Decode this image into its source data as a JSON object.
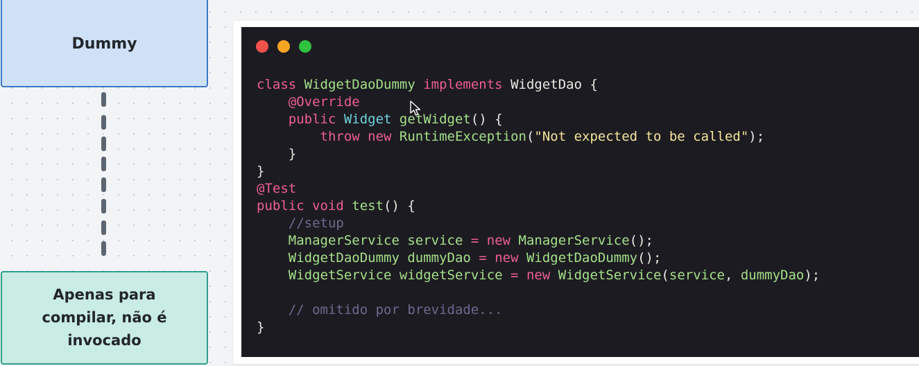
{
  "diagram": {
    "top_box": {
      "label": "Dummy"
    },
    "bottom_box": {
      "lines": [
        "Apenas para",
        "compilar, não é",
        "invocado"
      ]
    }
  },
  "window_controls": [
    {
      "name": "close-dot",
      "color": "#f0524b"
    },
    {
      "name": "minimize-dot",
      "color": "#f4a623"
    },
    {
      "name": "maximize-dot",
      "color": "#2fc23f"
    }
  ],
  "code_colors": {
    "keyword": "#ee5f93",
    "type": "#a5e089",
    "interface": "#ebe9e3",
    "annotation": "#ee5f93",
    "method": "#a5e089",
    "widget_type": "#6fd2de",
    "string": "#f2e59a",
    "comment": "#6d6a8f",
    "punct": "#ebe9e3",
    "plain": "#a5e089"
  },
  "code_lines": [
    [
      [
        "keyword",
        "class "
      ],
      [
        "type",
        "WidgetDaoDummy "
      ],
      [
        "keyword",
        "implements "
      ],
      [
        "interface",
        "WidgetDao "
      ],
      [
        "punct",
        "{"
      ]
    ],
    [
      [
        "plain",
        "    "
      ],
      [
        "annotation",
        "@Override"
      ]
    ],
    [
      [
        "plain",
        "    "
      ],
      [
        "keyword",
        "public "
      ],
      [
        "widget_type",
        "Widget "
      ],
      [
        "method",
        "getWidget"
      ],
      [
        "punct",
        "() {"
      ]
    ],
    [
      [
        "plain",
        "        "
      ],
      [
        "keyword",
        "throw "
      ],
      [
        "keyword",
        "new "
      ],
      [
        "method",
        "RuntimeException"
      ],
      [
        "punct",
        "("
      ],
      [
        "string",
        "\"Not expected to be called\""
      ],
      [
        "punct",
        ");"
      ]
    ],
    [
      [
        "plain",
        "    "
      ],
      [
        "punct",
        "}"
      ]
    ],
    [
      [
        "punct",
        "}"
      ]
    ],
    [
      [
        "annotation",
        "@Test"
      ]
    ],
    [
      [
        "keyword",
        "public "
      ],
      [
        "keyword",
        "void "
      ],
      [
        "method",
        "test"
      ],
      [
        "punct",
        "() {"
      ]
    ],
    [
      [
        "plain",
        "    "
      ],
      [
        "comment",
        "//setup"
      ]
    ],
    [
      [
        "plain",
        "    ManagerService service "
      ],
      [
        "keyword",
        "= "
      ],
      [
        "keyword",
        "new "
      ],
      [
        "plain",
        "ManagerService"
      ],
      [
        "punct",
        "();"
      ]
    ],
    [
      [
        "plain",
        "    WidgetDaoDummy dummyDao "
      ],
      [
        "keyword",
        "= "
      ],
      [
        "keyword",
        "new "
      ],
      [
        "plain",
        "WidgetDaoDummy"
      ],
      [
        "punct",
        "();"
      ]
    ],
    [
      [
        "plain",
        "    WidgetService widgetService "
      ],
      [
        "keyword",
        "= "
      ],
      [
        "keyword",
        "new "
      ],
      [
        "plain",
        "WidgetService"
      ],
      [
        "punct",
        "("
      ],
      [
        "plain",
        "service"
      ],
      [
        "punct",
        ", "
      ],
      [
        "plain",
        "dummyDao"
      ],
      [
        "punct",
        ");"
      ]
    ],
    [],
    [
      [
        "plain",
        "    "
      ],
      [
        "comment",
        "// omitido por brevidade..."
      ]
    ],
    [
      [
        "punct",
        "}"
      ]
    ]
  ]
}
